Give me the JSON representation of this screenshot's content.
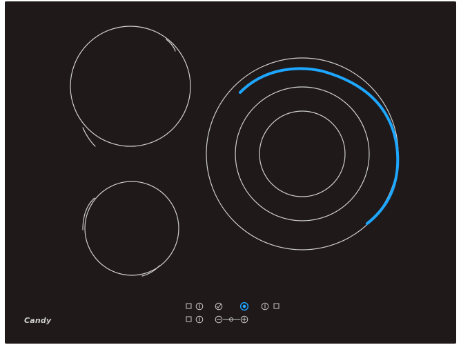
{
  "product": {
    "brand": "Candy"
  },
  "colors": {
    "glass": "#20191a",
    "ring_outline": "#cfcfcf",
    "accent_blue": "#1ea7ff",
    "controls": "#c9c9c9"
  },
  "zones": [
    {
      "id": "rear-left",
      "type": "single"
    },
    {
      "id": "front-left",
      "type": "single"
    },
    {
      "id": "right",
      "type": "triple",
      "dual_circuit": true
    }
  ],
  "controls": {
    "top_row": [
      "zone-select-rear-left",
      "zone-select-front-left",
      "timer",
      "power-on-off",
      "zone-select-right",
      "lock"
    ],
    "bottom_row": [
      "zone-select-front-left",
      "zone-select-right",
      "minus",
      "slider",
      "plus"
    ]
  }
}
